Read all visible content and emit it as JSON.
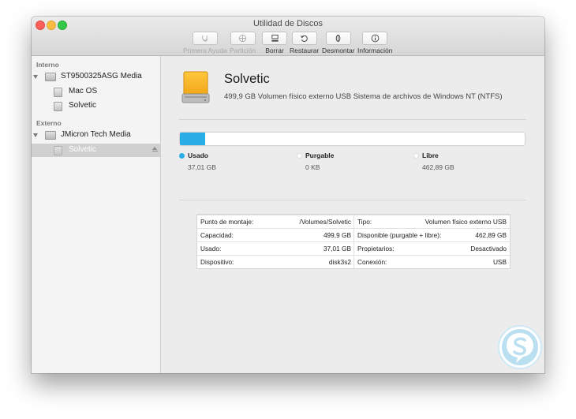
{
  "window": {
    "title": "Utilidad de Discos"
  },
  "toolbar": {
    "items": [
      {
        "label": "Primera Ayuda",
        "icon": "stethoscope-icon",
        "enabled": false
      },
      {
        "label": "Partición",
        "icon": "partition-icon",
        "enabled": false
      },
      {
        "label": "Borrar",
        "icon": "erase-icon",
        "enabled": true
      },
      {
        "label": "Restaurar",
        "icon": "restore-icon",
        "enabled": true
      },
      {
        "label": "Desmontar",
        "icon": "unmount-icon",
        "enabled": true
      },
      {
        "label": "Información",
        "icon": "info-icon",
        "enabled": true
      }
    ]
  },
  "sidebar": {
    "internal_header": "Interno",
    "external_header": "Externo",
    "internal_disk": "ST9500325ASG Media",
    "internal_volumes": [
      "Mac OS",
      "Solvetic"
    ],
    "external_disk": "JMicron Tech Media",
    "external_volumes": [
      "Solvetic"
    ]
  },
  "volume": {
    "name": "Solvetic",
    "description": "499,9 GB Volumen físico externo USB Sistema de archivos de Windows NT (NTFS)"
  },
  "usage": {
    "used_fraction": 0.074,
    "legend": [
      {
        "title": "Usado",
        "value": "37,01 GB",
        "color": "#29aee8"
      },
      {
        "title": "Purgable",
        "value": "0 KB",
        "color": "#ffffff"
      },
      {
        "title": "Libre",
        "value": "462,89 GB",
        "color": "#ffffff"
      }
    ]
  },
  "info": {
    "rows": [
      {
        "l_label": "Punto de montaje:",
        "l_value": "/Volumes/Solvetic",
        "r_label": "Tipo:",
        "r_value": "Volumen físico externo USB"
      },
      {
        "l_label": "Capacidad:",
        "l_value": "499,9 GB",
        "r_label": "Disponible (purgable + libre):",
        "r_value": "462,89 GB"
      },
      {
        "l_label": "Usado:",
        "l_value": "37,01 GB",
        "r_label": "Propietarios:",
        "r_value": "Desactivado"
      },
      {
        "l_label": "Dispositivo:",
        "l_value": "disk3s2",
        "r_label": "Conexión:",
        "r_value": "USB"
      }
    ]
  },
  "colors": {
    "accent": "#29aee8",
    "drive": "#f5a623",
    "logo": "#b9dff0"
  }
}
